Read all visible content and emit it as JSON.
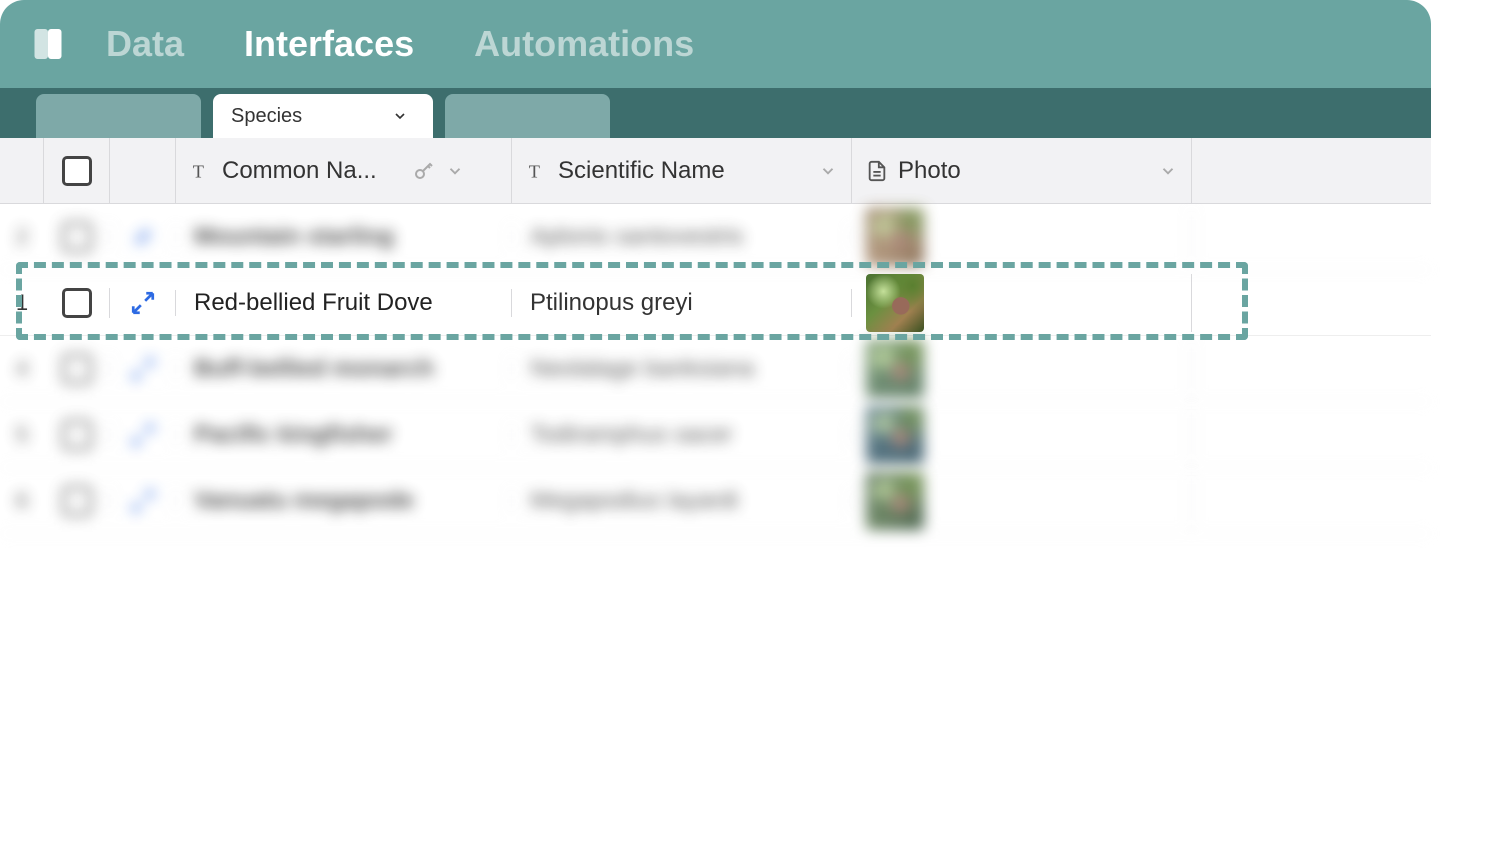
{
  "colors": {
    "teal": "#6aa5a1",
    "teal_dark": "#3d6e6d",
    "blue": "#2d6ae3"
  },
  "nav": {
    "data": "Data",
    "interfaces": "Interfaces",
    "automations": "Automations",
    "active": "interfaces"
  },
  "tab": {
    "label": "Species"
  },
  "columns": {
    "common": "Common Na...",
    "scientific": "Scientific Name",
    "photo": "Photo"
  },
  "highlighted_row": {
    "num": "1",
    "common": "Red-bellied Fruit Dove",
    "scientific": "Ptilinopus greyi"
  },
  "blurred_rows": [
    {
      "num": "2",
      "common": "Mountain starling",
      "scientific": "Aplonis santovestris"
    },
    {
      "num": "4",
      "common": "Buff-bellied monarch",
      "scientific": "Neolalage banksiana"
    },
    {
      "num": "5",
      "common": "Pacific kingfisher",
      "scientific": "Todiramphus sacer"
    },
    {
      "num": "6",
      "common": "Vanuatu megapode",
      "scientific": "Megapodius layardi"
    }
  ]
}
